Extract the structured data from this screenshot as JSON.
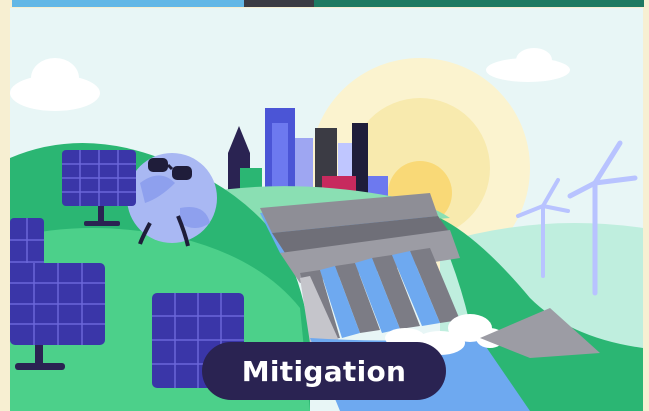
{
  "label": "Mitigation",
  "colors": {
    "sky": "#e6f5f7",
    "sun": "#f9d977",
    "grass_dark": "#2bb673",
    "grass_mid": "#4cd08a",
    "grass_light": "#9fe6bf",
    "panel": "#3a36a8",
    "panel_grid": "#6b67d9",
    "dam": "#8e8e96",
    "water": "#6ea9f0",
    "pill": "#2a2352",
    "turbine": "#b8c3ff"
  },
  "icons": [
    "solar-panel-icon",
    "earth-character-icon",
    "city-skyline-icon",
    "hydro-dam-icon",
    "wind-turbine-icon",
    "sun-icon",
    "cloud-icon"
  ]
}
